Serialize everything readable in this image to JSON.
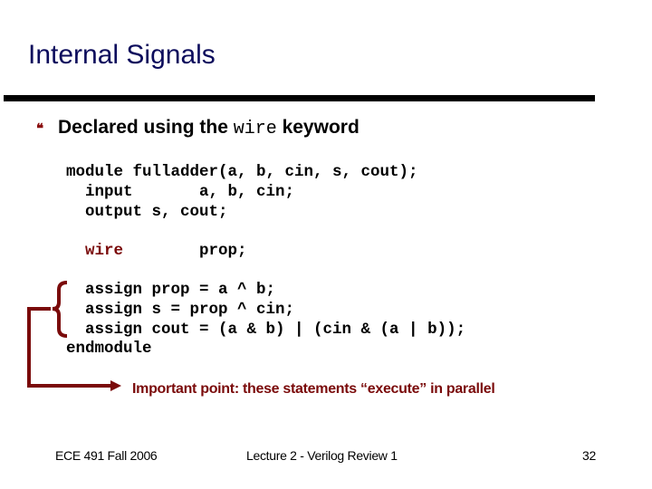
{
  "slide": {
    "title": "Internal Signals",
    "bullet": {
      "icon": "quote-bullet-icon",
      "glyph": "❝",
      "text_before": "Declared using the ",
      "keyword": "wire",
      "text_after": " keyword"
    },
    "code": {
      "line1": "module fulladder(a, b, cin, s, cout);",
      "line2": "  input       a, b, cin;",
      "line3": "  output s, cout;",
      "line4_kw": "wire",
      "line4_rest": "        prop;",
      "line5": "  assign prop = a ^ b;",
      "line6": "  assign s = prop ^ cin;",
      "line7": "  assign cout = (a & b) | (cin & (a | b));",
      "line8": "endmodule"
    },
    "note": "Important point: these statements “execute” in parallel",
    "footer": {
      "left": "ECE 491 Fall 2006",
      "center": "Lecture 2 - Verilog Review 1",
      "page_number": "32"
    },
    "colors": {
      "title": "#0c0c5c",
      "accent": "#7a0a0a",
      "rule": "#000000"
    }
  }
}
